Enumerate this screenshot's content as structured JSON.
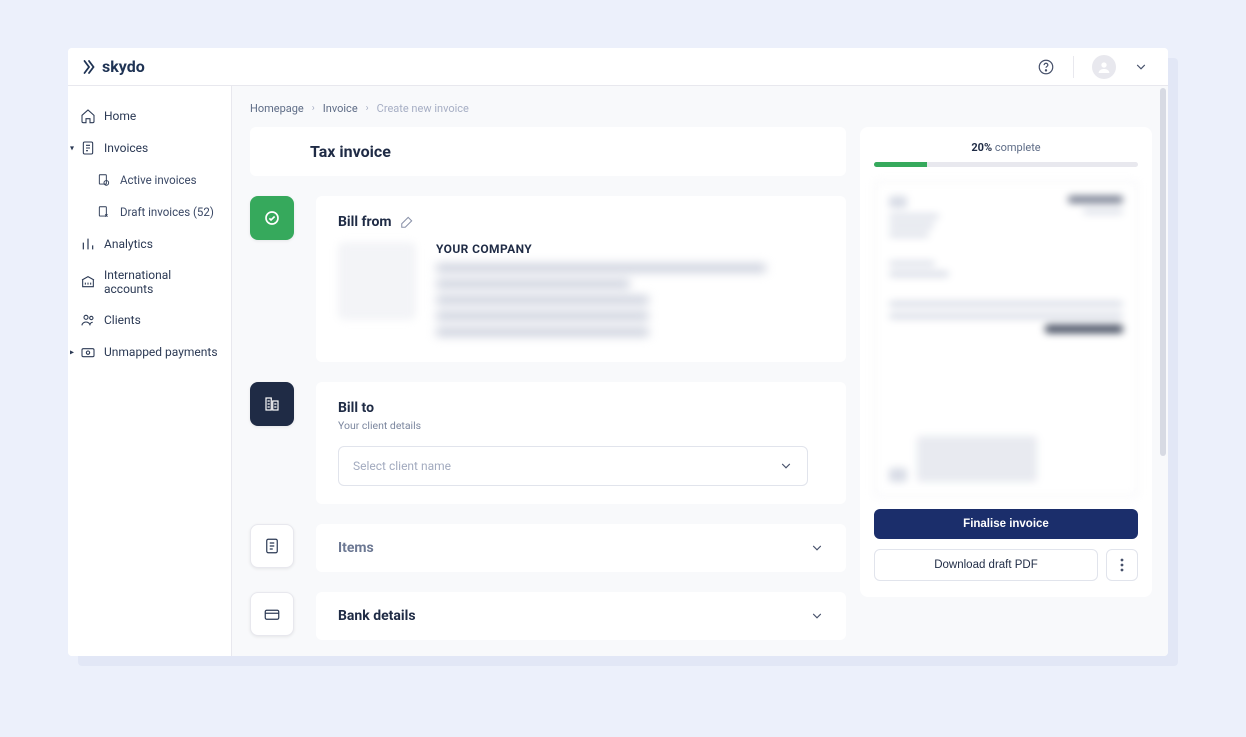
{
  "brand": "skydo",
  "sidebar": {
    "items": [
      {
        "label": "Home"
      },
      {
        "label": "Invoices"
      },
      {
        "label": "Active invoices"
      },
      {
        "label": "Draft invoices (52)"
      },
      {
        "label": "Analytics"
      },
      {
        "label": "International accounts"
      },
      {
        "label": "Clients"
      },
      {
        "label": "Unmapped payments"
      }
    ]
  },
  "breadcrumb": {
    "home": "Homepage",
    "invoice": "Invoice",
    "current": "Create new invoice"
  },
  "page": {
    "title": "Tax invoice"
  },
  "bill_from": {
    "title": "Bill from",
    "company": "YOUR COMPANY"
  },
  "bill_to": {
    "title": "Bill to",
    "subtitle": "Your client details",
    "placeholder": "Select client name"
  },
  "items_section": {
    "title": "Items"
  },
  "bank_section": {
    "title": "Bank details"
  },
  "preview": {
    "progress_percent": "20%",
    "progress_word": "complete",
    "finalise": "Finalise invoice",
    "download": "Download draft PDF"
  }
}
